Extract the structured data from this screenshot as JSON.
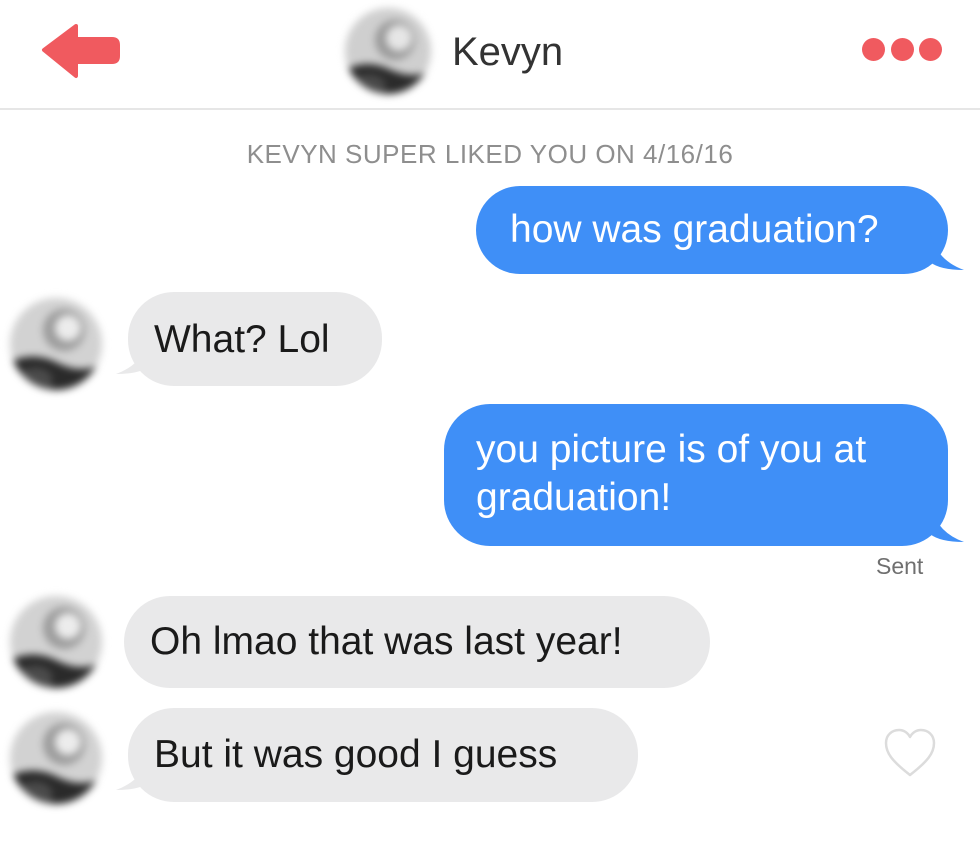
{
  "header": {
    "name": "Kevyn",
    "back_icon": "back-arrow-icon",
    "more_icon": "more-dots-icon",
    "accent_color": "#f05a5f"
  },
  "match_notice": "KEVYN SUPER LIKED YOU ON 4/16/16",
  "messages": [
    {
      "direction": "sent",
      "text": "how was graduation?"
    },
    {
      "direction": "received",
      "text": "What? Lol"
    },
    {
      "direction": "sent",
      "lines": [
        "you picture is of you at",
        "graduation!"
      ]
    },
    {
      "direction": "received",
      "text": "Oh lmao that was last year!"
    },
    {
      "direction": "received",
      "text": "But it was good I guess"
    }
  ],
  "delivery_status": "Sent",
  "like_icon": "heart-outline-icon",
  "colors": {
    "sent_bubble": "#3f8ff7",
    "received_bubble": "#e9e9ea",
    "status_text": "#8e8e8e"
  }
}
